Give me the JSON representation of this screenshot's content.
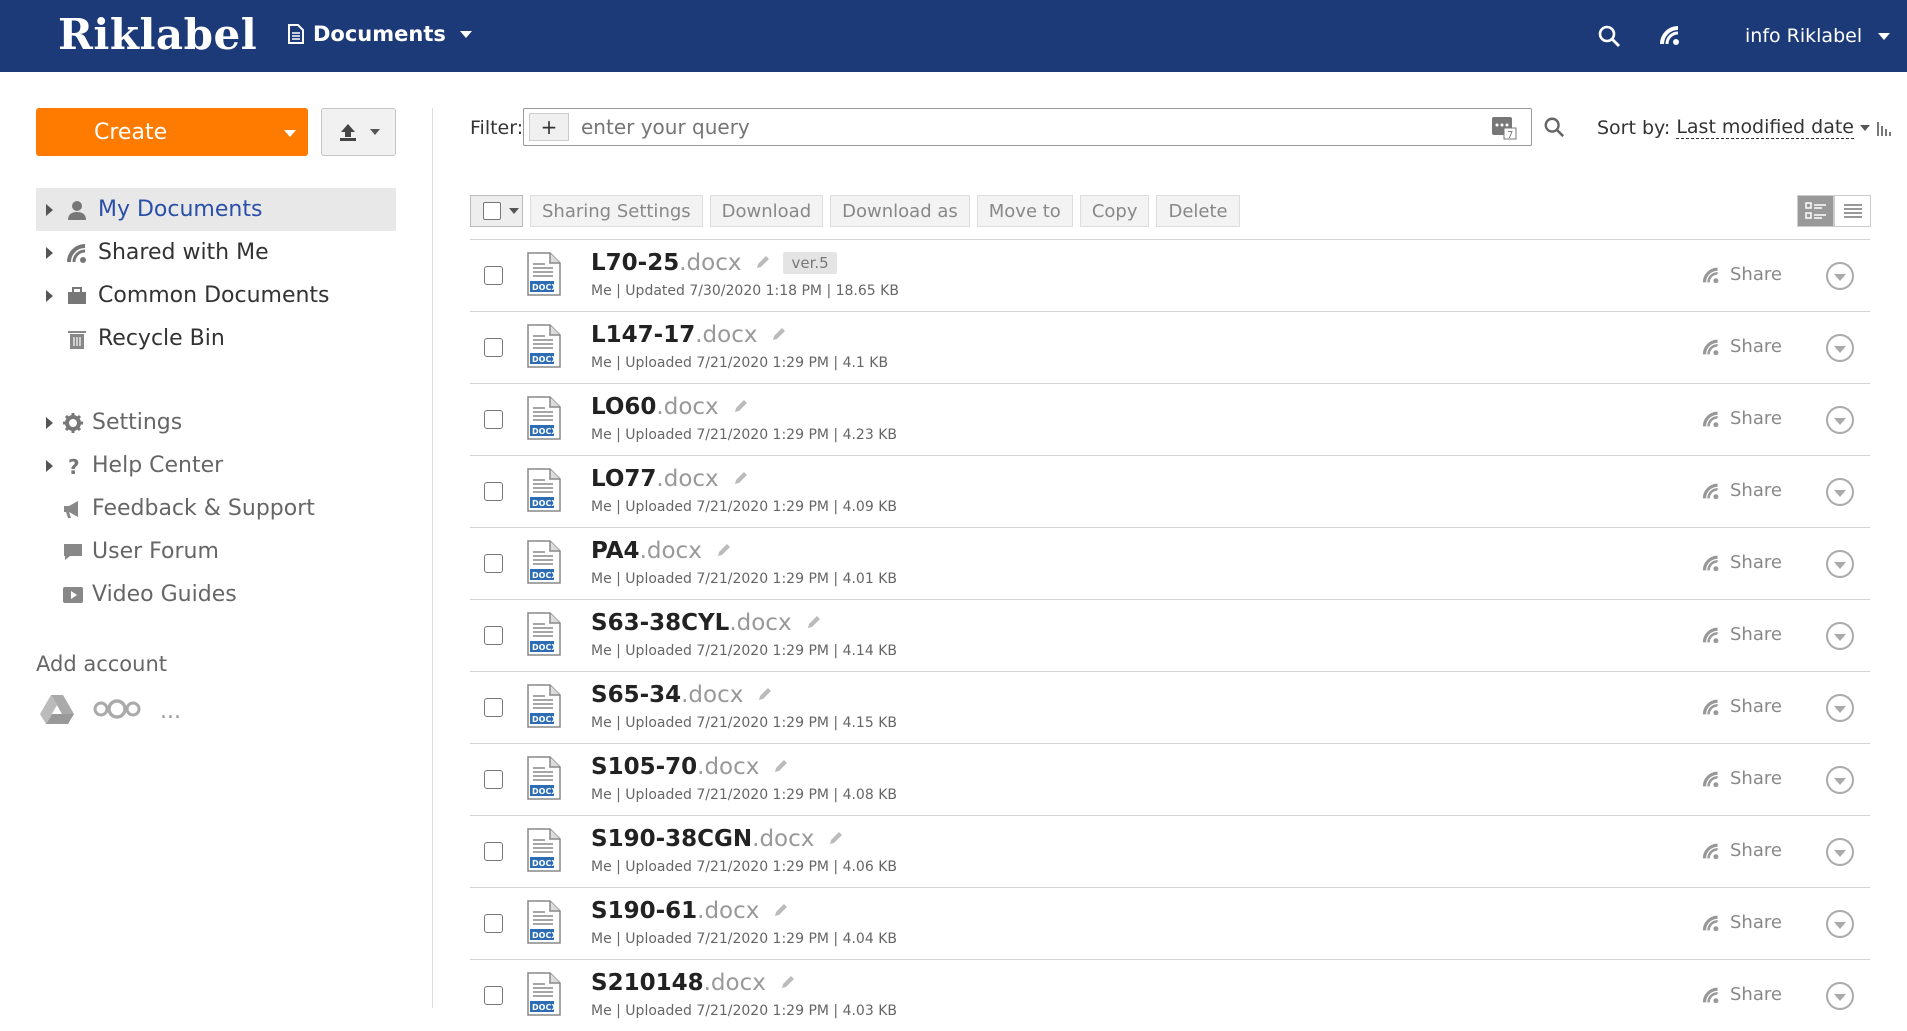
{
  "app": {
    "logo": "Riklabel",
    "module": "Documents",
    "user": "info Riklabel"
  },
  "sidebar": {
    "create_label": "Create",
    "nav": [
      {
        "label": "My Documents",
        "icon": "user-icon",
        "active": true
      },
      {
        "label": "Shared with Me",
        "icon": "share-icon"
      },
      {
        "label": "Common Documents",
        "icon": "briefcase-icon"
      },
      {
        "label": "Recycle Bin",
        "icon": "trash-icon"
      }
    ],
    "nav2": [
      {
        "label": "Settings",
        "icon": "gear-icon"
      },
      {
        "label": "Help Center",
        "icon": "question-icon"
      },
      {
        "label": "Feedback & Support",
        "icon": "megaphone-icon"
      },
      {
        "label": "User Forum",
        "icon": "chat-icon"
      },
      {
        "label": "Video Guides",
        "icon": "play-icon"
      }
    ],
    "add_account": "Add account",
    "account_more": "..."
  },
  "filter": {
    "label": "Filter:",
    "plus": "+",
    "placeholder": "enter your query"
  },
  "sort": {
    "label": "Sort by:",
    "value": "Last modified date"
  },
  "toolbar": {
    "sharing_settings": "Sharing Settings",
    "download": "Download",
    "download_as": "Download as",
    "move_to": "Move to",
    "copy": "Copy",
    "delete": "Delete"
  },
  "share_label": "Share",
  "files": [
    {
      "name": "L70-25",
      "ext": ".docx",
      "version": "ver.5",
      "meta": "Me | Updated 7/30/2020 1:18 PM | 18.65 KB"
    },
    {
      "name": "L147-17",
      "ext": ".docx",
      "meta": "Me | Uploaded 7/21/2020 1:29 PM | 4.1 KB"
    },
    {
      "name": "LO60",
      "ext": ".docx",
      "meta": "Me | Uploaded 7/21/2020 1:29 PM | 4.23 KB"
    },
    {
      "name": "LO77",
      "ext": ".docx",
      "meta": "Me | Uploaded 7/21/2020 1:29 PM | 4.09 KB"
    },
    {
      "name": "PA4",
      "ext": ".docx",
      "meta": "Me | Uploaded 7/21/2020 1:29 PM | 4.01 KB"
    },
    {
      "name": "S63-38CYL",
      "ext": ".docx",
      "meta": "Me | Uploaded 7/21/2020 1:29 PM | 4.14 KB"
    },
    {
      "name": "S65-34",
      "ext": ".docx",
      "meta": "Me | Uploaded 7/21/2020 1:29 PM | 4.15 KB"
    },
    {
      "name": "S105-70",
      "ext": ".docx",
      "meta": "Me | Uploaded 7/21/2020 1:29 PM | 4.08 KB"
    },
    {
      "name": "S190-38CGN",
      "ext": ".docx",
      "meta": "Me | Uploaded 7/21/2020 1:29 PM | 4.06 KB"
    },
    {
      "name": "S190-61",
      "ext": ".docx",
      "meta": "Me | Uploaded 7/21/2020 1:29 PM | 4.04 KB"
    },
    {
      "name": "S210148",
      "ext": ".docx",
      "meta": "Me | Uploaded 7/21/2020 1:29 PM | 4.03 KB"
    }
  ],
  "file_badge": "DOCX",
  "colors": {
    "topbar": "#1d3a78",
    "create": "#ff7b00",
    "active_link": "#2a4fa8"
  }
}
